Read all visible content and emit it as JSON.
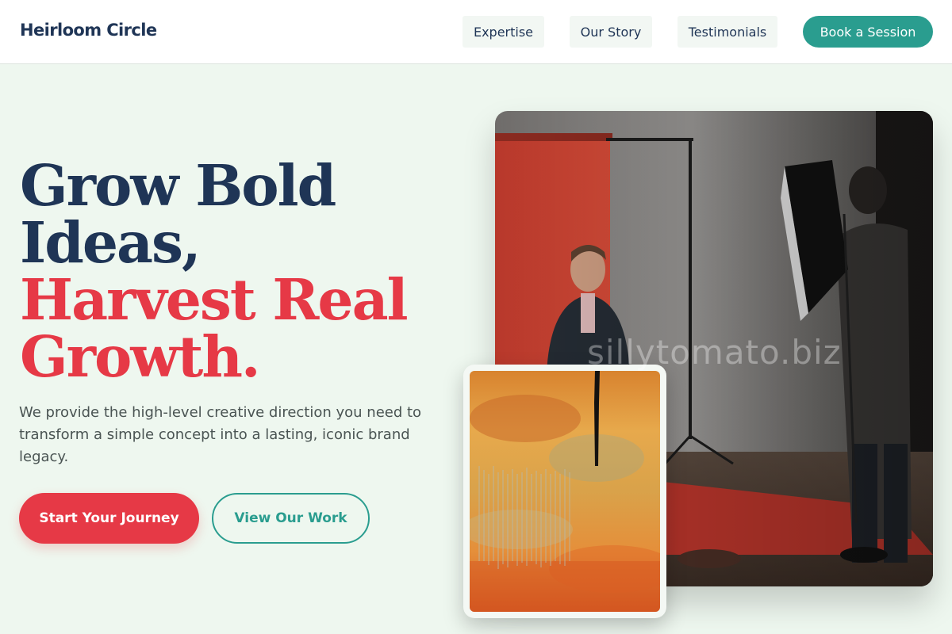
{
  "header": {
    "brand": "Heirloom Circle",
    "nav": [
      {
        "label": "Expertise"
      },
      {
        "label": "Our Story"
      },
      {
        "label": "Testimonials"
      }
    ],
    "cta_label": "Book a Session"
  },
  "hero": {
    "title_lines": [
      "Grow Bold",
      "Ideas,",
      "Harvest Real",
      "Growth."
    ],
    "description": "We provide the high-level creative direction you need to transform a simple concept into a lasting, iconic brand legacy.",
    "primary_button": "Start Your Journey",
    "secondary_button": "View Our Work"
  },
  "images": {
    "main_photo": "photo-studio-shoot",
    "art_photo": "abstract-orange-painting"
  },
  "watermark": "sillytomato.biz",
  "colors": {
    "navy": "#1f3556",
    "accent_red": "#e63946",
    "teal": "#2a9d8f",
    "background": "#eef7ef"
  }
}
